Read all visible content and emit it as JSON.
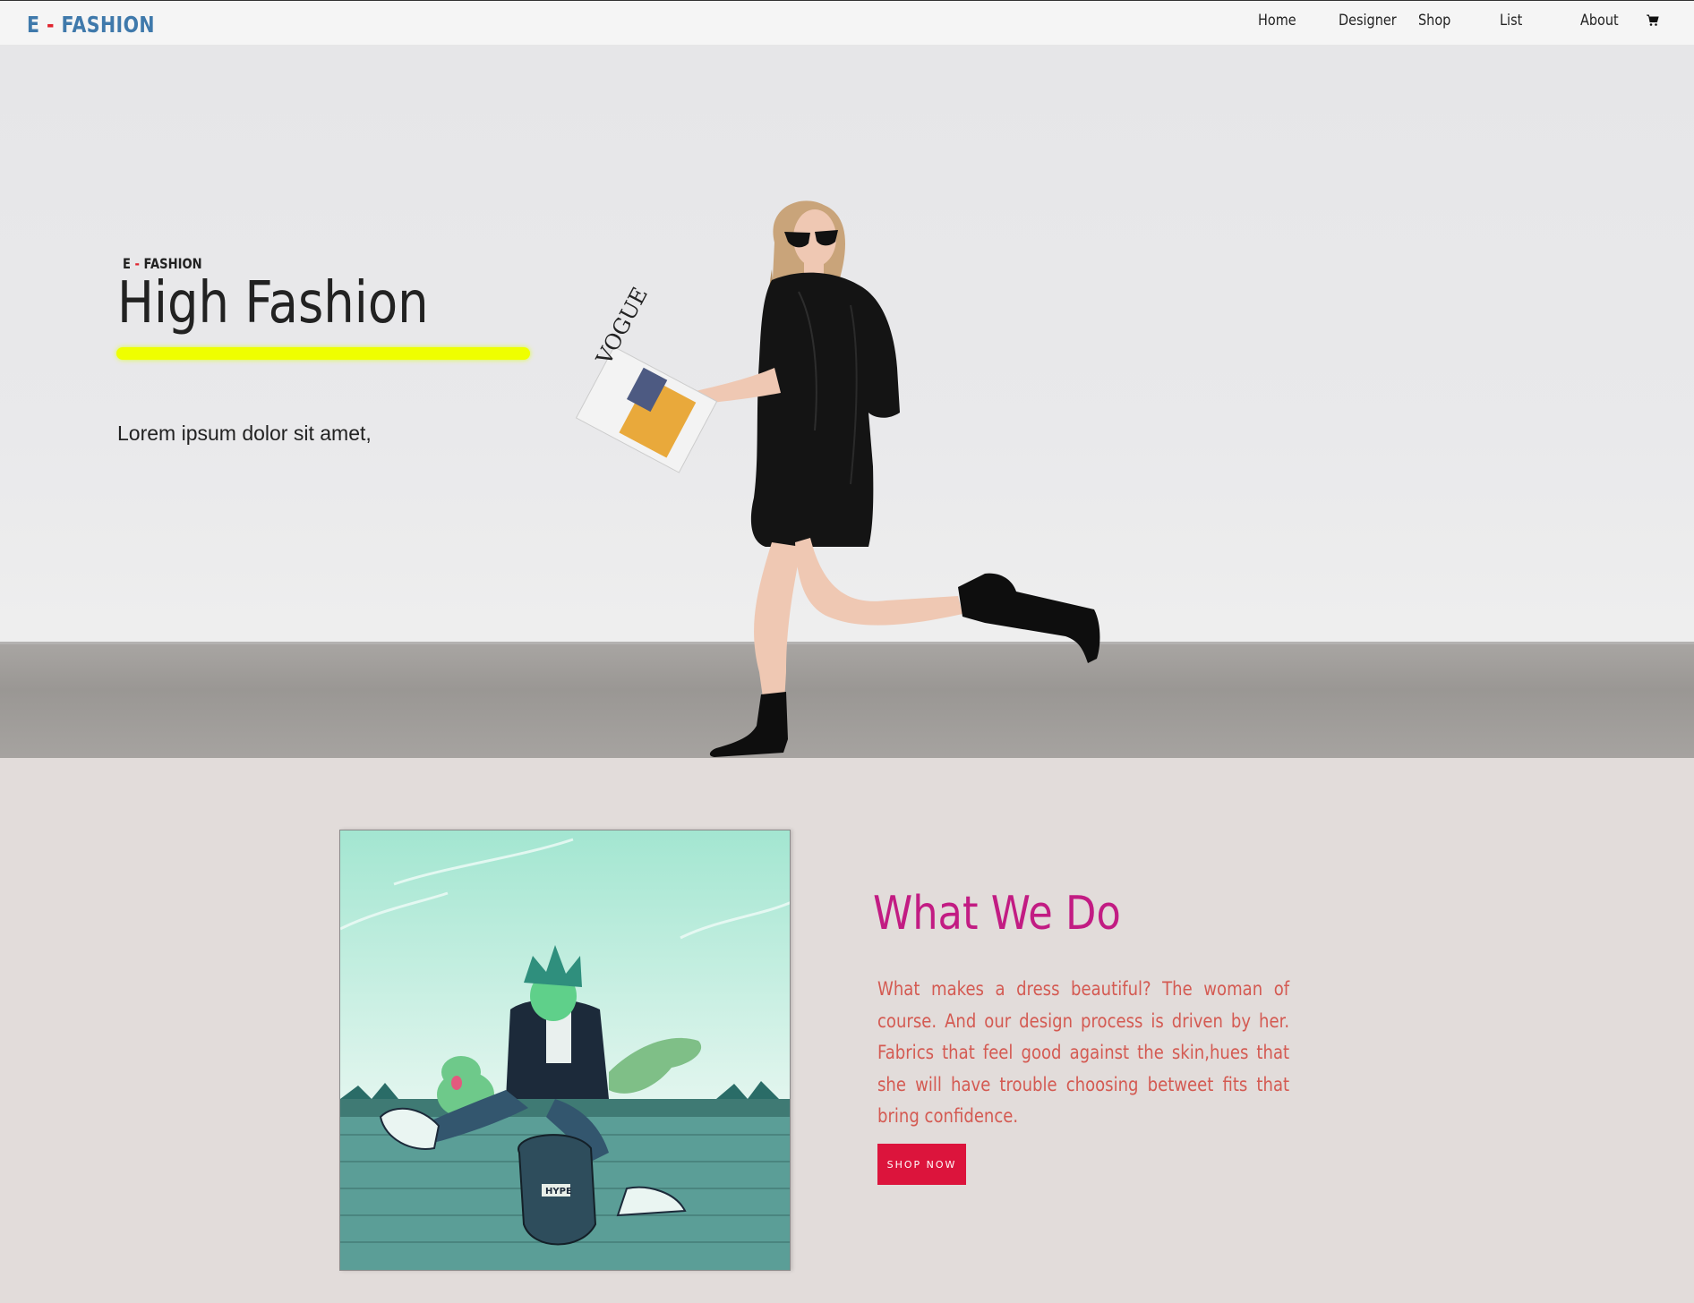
{
  "nav": {
    "brand": {
      "prefix": "E",
      "dash": "-",
      "name": "FASHION"
    },
    "items": [
      {
        "label": "Home"
      },
      {
        "label": "Designer"
      },
      {
        "label": "Shop"
      },
      {
        "label": "List"
      },
      {
        "label": "About"
      }
    ],
    "cart_icon": "cart-icon"
  },
  "hero": {
    "eyebrow": {
      "prefix": "E",
      "dash": "-",
      "name": "FASHION"
    },
    "title": "High Fashion",
    "subtitle": "Lorem ipsum dolor sit amet,",
    "magazine_text": "VOGUE"
  },
  "about": {
    "title": "What We Do",
    "text": "What makes a dress beautiful? The woman of course. And our design process is driven by her. Fabrics that feel good against the skin,hues that she will have trouble choosing betweet fits that bring confidence.",
    "button_label": "SHOP NOW",
    "illustration_text": "HYPE"
  },
  "colors": {
    "brand_blue": "#3f79ab",
    "accent_red": "#e0242e",
    "highlight_yellow": "#efff00",
    "section_title_magenta": "#c21c83",
    "section_text": "#d45a52",
    "button_bg": "#dc143c",
    "section_bg": "#e2dcda"
  }
}
